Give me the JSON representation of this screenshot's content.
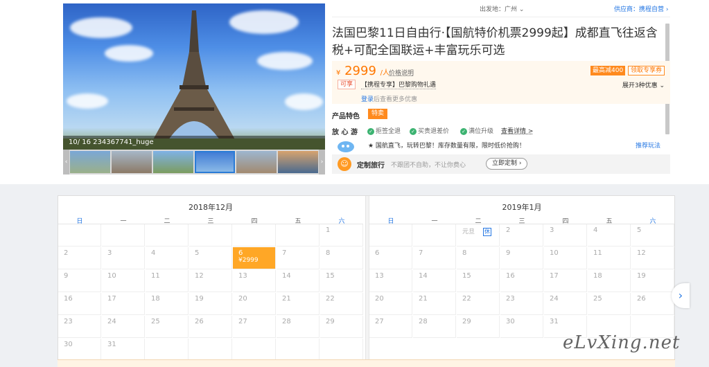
{
  "topbar": {
    "departure": "出发地：广州",
    "supplier": "供应商：携程自营"
  },
  "gallery": {
    "caption": "10/ 16 234367741_huge",
    "thumbs": [
      "thumb-1",
      "thumb-2",
      "thumb-3",
      "thumb-4",
      "thumb-5",
      "thumb-6"
    ],
    "active_index": 3
  },
  "product": {
    "title": "法国巴黎11日自由行·【国航特价机票2999起】成都直飞往返含税+可配全国联运+丰富玩乐可选",
    "price_symbol": "¥",
    "price": "2999",
    "price_unit": "/人",
    "price_note": "价格说明",
    "coupon_badge": "最高减400",
    "coupon_link": "领取专享券",
    "promo_tag": "可享",
    "promo_text": "【携程专享】巴黎购物礼遇",
    "expand_text": "展开3种优惠",
    "login_link": "登录",
    "login_text": "后查看更多优惠"
  },
  "features": {
    "label": "产品特色",
    "tag": "特卖",
    "assure_label": "放 心 游",
    "assure_items": [
      "拒签全退",
      "买贵退差价",
      "满位升级"
    ],
    "assure_more": "查看详情 >"
  },
  "recommend": {
    "text": "★ 国航直飞，玩转巴黎！库存数量有限，限时低价抢购！",
    "link": "推荐玩法"
  },
  "custom": {
    "title": "定制旅行",
    "subtitle": "不跟团不自助，不让你费心",
    "button": "立即定制 ›"
  },
  "calendar": {
    "weekdays": [
      "日",
      "一",
      "二",
      "三",
      "四",
      "五",
      "六"
    ],
    "months": [
      {
        "title": "2018年12月",
        "rows": [
          [
            "",
            "",
            "",
            "",
            "",
            "",
            "1"
          ],
          [
            "2",
            "3",
            "4",
            "5",
            "6",
            "7",
            "8"
          ],
          [
            "9",
            "10",
            "11",
            "12",
            "13",
            "14",
            "15"
          ],
          [
            "16",
            "17",
            "18",
            "19",
            "20",
            "21",
            "22"
          ],
          [
            "23",
            "24",
            "25",
            "26",
            "27",
            "28",
            "29"
          ],
          [
            "30",
            "31",
            "",
            "",
            "",
            "",
            ""
          ]
        ],
        "selected": {
          "day": "6",
          "price": "¥2999"
        }
      },
      {
        "title": "2019年1月",
        "rows": [
          [
            "",
            "",
            "元旦",
            "2",
            "3",
            "4",
            "5"
          ],
          [
            "6",
            "7",
            "8",
            "9",
            "10",
            "11",
            "12"
          ],
          [
            "13",
            "14",
            "15",
            "16",
            "17",
            "18",
            "19"
          ],
          [
            "20",
            "21",
            "22",
            "23",
            "24",
            "25",
            "26"
          ],
          [
            "27",
            "28",
            "29",
            "30",
            "31",
            "",
            ""
          ]
        ],
        "holiday_rest_label": "休"
      }
    ],
    "next_arrow": "›"
  },
  "watermark": "eLvXing.net",
  "colors": {
    "accent": "#ff8a1e",
    "link": "#2577e3",
    "selected": "#ffa726"
  }
}
